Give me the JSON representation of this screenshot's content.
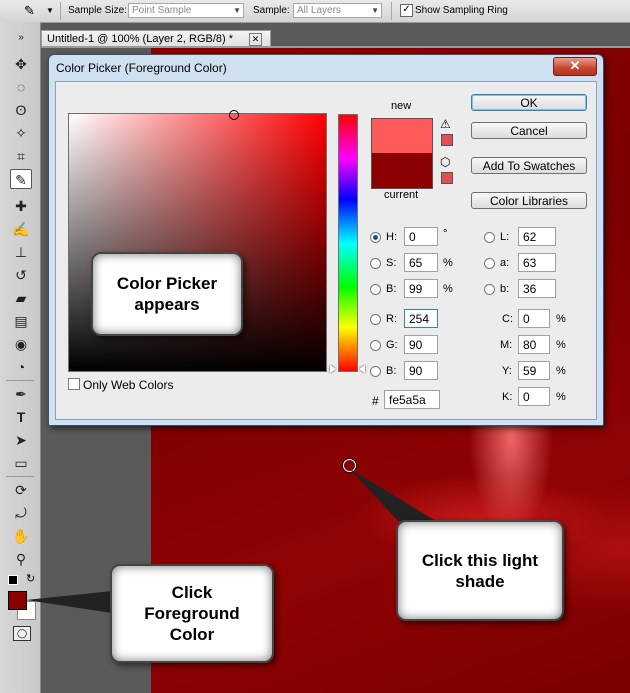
{
  "options_bar": {
    "sample_size_label": "Sample Size:",
    "sample_size_value": "Point Sample",
    "sample_label": "Sample:",
    "sample_value": "All Layers",
    "show_ring_label": "Show Sampling Ring",
    "show_ring_checked": true
  },
  "document": {
    "tab_title": "Untitled-1 @ 100% (Layer 2, RGB/8) *",
    "close_glyph": "✕"
  },
  "dialog": {
    "title": "Color Picker (Foreground Color)",
    "close_glyph": "✕",
    "new_label": "new",
    "current_label": "current",
    "new_color": "#fe5a5a",
    "current_color": "#8b0000",
    "buttons": {
      "ok": "OK",
      "cancel": "Cancel",
      "add_to_swatches": "Add To Swatches",
      "color_libraries": "Color Libraries"
    },
    "hsb": [
      {
        "label": "H:",
        "value": "0",
        "unit": "°",
        "selected": true
      },
      {
        "label": "S:",
        "value": "65",
        "unit": "%",
        "selected": false
      },
      {
        "label": "B:",
        "value": "99",
        "unit": "%",
        "selected": false
      }
    ],
    "rgb": [
      {
        "label": "R:",
        "value": "254"
      },
      {
        "label": "G:",
        "value": "90"
      },
      {
        "label": "B:",
        "value": "90"
      }
    ],
    "lab": [
      {
        "label": "L:",
        "value": "62"
      },
      {
        "label": "a:",
        "value": "63"
      },
      {
        "label": "b:",
        "value": "36"
      }
    ],
    "cmyk": [
      {
        "label": "C:",
        "value": "0",
        "unit": "%"
      },
      {
        "label": "M:",
        "value": "80",
        "unit": "%"
      },
      {
        "label": "Y:",
        "value": "59",
        "unit": "%"
      },
      {
        "label": "K:",
        "value": "0",
        "unit": "%"
      }
    ],
    "hex_label": "#",
    "hex_value": "fe5a5a",
    "only_web_colors_label": "Only Web Colors",
    "only_web_colors_checked": false
  },
  "callouts": {
    "color_picker": "Color Picker appears",
    "light_shade": "Click this light shade",
    "foreground": "Click Foreground Color"
  },
  "colors": {
    "foreground": "#8b0000",
    "background": "#ffffff",
    "canvas": "#8b0000"
  }
}
